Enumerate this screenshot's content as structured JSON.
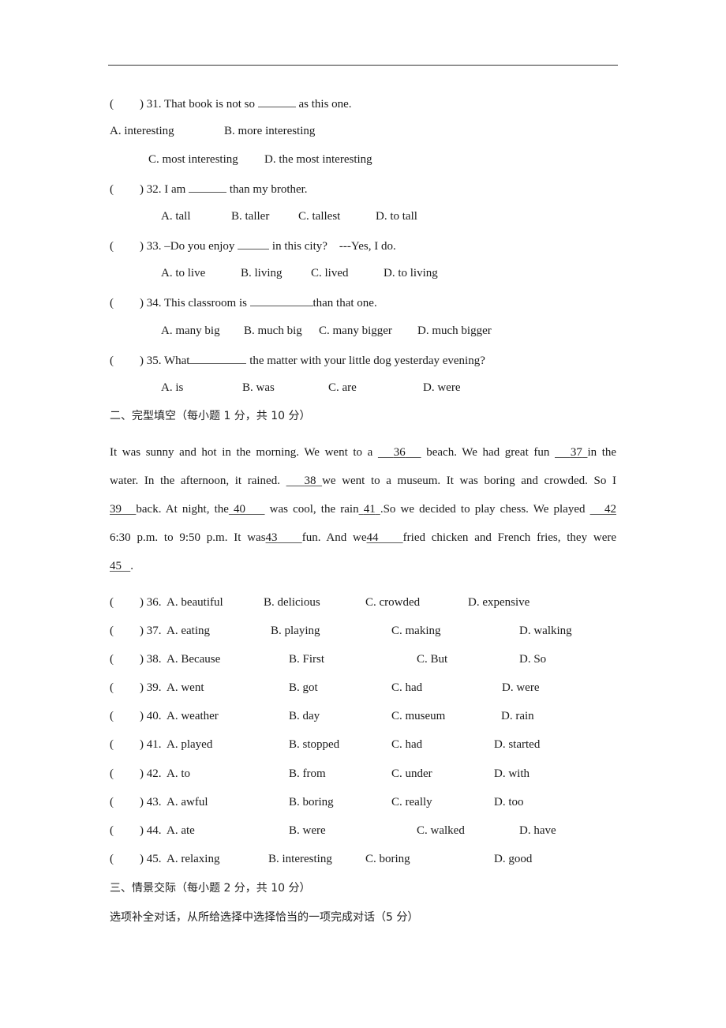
{
  "section1": {
    "questions": [
      {
        "paren": "(",
        "close": ")",
        "number": "31.",
        "stem_before": "That book is not so",
        "stem_after": "as this one.",
        "options": [
          "A. interesting",
          "B. more interesting",
          "C. most interesting",
          "D. the most interesting"
        ]
      },
      {
        "paren": "(",
        "close": ")",
        "number": "32.",
        "stem_before": "I am",
        "stem_after": "than my brother.",
        "options": [
          "A. tall",
          "B. taller",
          "C. tallest",
          "D. to tall"
        ]
      },
      {
        "paren": "(",
        "close": ")",
        "number": "33.",
        "stem_before": "–Do you enjoy",
        "stem_after": "in this city?    ---Yes, I do.",
        "options": [
          "A. to live",
          "B. living",
          "C. lived",
          "D. to living"
        ]
      },
      {
        "paren": "(",
        "close": ")",
        "number": "34.",
        "stem_before": "This classroom is",
        "stem_after": "than that one.",
        "options": [
          "A. many big",
          "B. much big",
          "C. many bigger",
          "D. much bigger"
        ]
      },
      {
        "paren": "(",
        "close": ")",
        "number": "35.",
        "stem_before": "What",
        "stem_after": "the matter with your little dog yesterday evening?",
        "options": [
          "A. is",
          "B. was",
          "C. are",
          "D. were"
        ]
      }
    ]
  },
  "section2": {
    "heading": "二、完型填空（每小题 1 分，共 10 分）",
    "passage": {
      "line1": {
        "t1": "It was sunny and hot in the morning. We went to a",
        "b1": "36",
        "t2": "beach. We had great fun",
        "b2": "37",
        "t3": "in the"
      },
      "line2": {
        "t1": "water. In the afternoon, it rained.",
        "b1": "38",
        "t2": "we went to a museum. It was boring and crowded. So I"
      },
      "line3": {
        "b1": "39",
        "t1": "back. At night, the",
        "b2": "40",
        "t2": "was cool, the rain",
        "b3": "41",
        "t3": ".So we decided to play chess. We played",
        "b4": "42"
      },
      "line4": {
        "t1": "6:30 p.m. to 9:50 p.m. It was",
        "b1": "43",
        "t2": "fun. And we",
        "b2": "44",
        "t3": "fried chicken and French fries, they were"
      },
      "line5": {
        "b1": "45",
        "t1": "."
      }
    },
    "questions": [
      {
        "number": "36.",
        "options": [
          "A. beautiful",
          "B. delicious",
          "C. crowded",
          "D. expensive"
        ]
      },
      {
        "number": "37.",
        "options": [
          "A. eating",
          "B. playing",
          "C. making",
          "D. walking"
        ]
      },
      {
        "number": "38.",
        "options": [
          "A. Because",
          "B. First",
          "C. But",
          "D. So"
        ]
      },
      {
        "number": "39.",
        "options": [
          "A. went",
          "B. got",
          "C. had",
          "D. were"
        ]
      },
      {
        "number": "40.",
        "options": [
          "A. weather",
          "B. day",
          "C. museum",
          "D. rain"
        ]
      },
      {
        "number": "41.",
        "options": [
          "A. played",
          "B. stopped",
          "C. had",
          "D. started"
        ]
      },
      {
        "number": "42.",
        "options": [
          "A. to",
          "B. from",
          "C. under",
          "D. with"
        ]
      },
      {
        "number": "43.",
        "options": [
          "A. awful",
          "B. boring",
          "C. really",
          "D. too"
        ]
      },
      {
        "number": "44.",
        "options": [
          "A. ate",
          "B. were",
          "C. walked",
          "D. have"
        ]
      },
      {
        "number": "45.",
        "options": [
          "A. relaxing",
          "B. interesting",
          "C. boring",
          "D. good"
        ]
      }
    ]
  },
  "section3": {
    "heading": "三、情景交际（每小题 2 分，共 10 分）",
    "instruction": "选项补全对话，从所给选择中选择恰当的一项完成对话（5 分）"
  }
}
